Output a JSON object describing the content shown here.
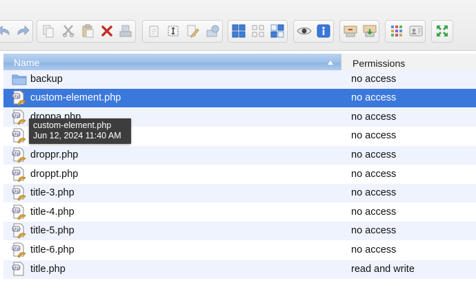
{
  "toolbar": {
    "buttons": [
      {
        "id": "undo",
        "icon": "undo-icon"
      },
      {
        "id": "redo",
        "icon": "redo-icon"
      },
      {
        "id": "copy",
        "icon": "copy-icon"
      },
      {
        "id": "cut",
        "icon": "cut-icon"
      },
      {
        "id": "paste",
        "icon": "paste-icon"
      },
      {
        "id": "delete",
        "icon": "delete-x-icon"
      },
      {
        "id": "move",
        "icon": "move-to-icon"
      },
      {
        "id": "duplicate",
        "icon": "duplicate-icon"
      },
      {
        "id": "rename",
        "icon": "rename-icon"
      },
      {
        "id": "edit",
        "icon": "edit-file-icon"
      },
      {
        "id": "extract",
        "icon": "extract-icon"
      },
      {
        "id": "view-icons",
        "icon": "view-icons-icon"
      },
      {
        "id": "view-small",
        "icon": "view-small-icons-icon"
      },
      {
        "id": "view-list",
        "icon": "view-list-icon"
      },
      {
        "id": "preview",
        "icon": "eye-icon"
      },
      {
        "id": "info",
        "icon": "info-icon"
      },
      {
        "id": "upload",
        "icon": "upload-icon"
      },
      {
        "id": "download",
        "icon": "download-icon"
      },
      {
        "id": "select-all",
        "icon": "grid-select-icon"
      },
      {
        "id": "permissions",
        "icon": "permissions-icon"
      },
      {
        "id": "fullscreen",
        "icon": "fullscreen-icon"
      }
    ]
  },
  "columns": {
    "name": "Name",
    "permissions": "Permissions"
  },
  "files": [
    {
      "name": "backup",
      "type": "folder",
      "permissions": "no access"
    },
    {
      "name": "custom-element.php",
      "type": "php",
      "permissions": "no access",
      "selected": true
    },
    {
      "name": "droppa.php",
      "type": "php",
      "permissions": "no access"
    },
    {
      "name": "",
      "type": "php",
      "permissions": "no access"
    },
    {
      "name": "droppr.php",
      "type": "php",
      "permissions": "no access"
    },
    {
      "name": "droppt.php",
      "type": "php",
      "permissions": "no access"
    },
    {
      "name": "title-3.php",
      "type": "php",
      "permissions": "no access"
    },
    {
      "name": "title-4.php",
      "type": "php",
      "permissions": "no access"
    },
    {
      "name": "title-5.php",
      "type": "php",
      "permissions": "no access"
    },
    {
      "name": "title-6.php",
      "type": "php",
      "permissions": "no access"
    },
    {
      "name": "title.php",
      "type": "php-rw",
      "permissions": "read and write"
    }
  ],
  "tooltip": {
    "name": "custom-element.php",
    "date": "Jun 12, 2024 11:40 AM"
  }
}
